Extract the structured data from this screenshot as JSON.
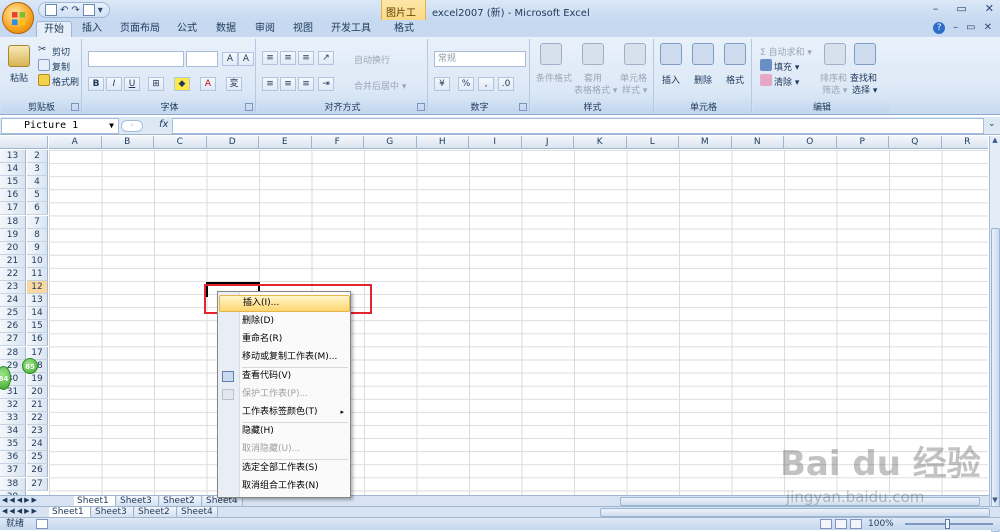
{
  "window": {
    "title": "excel2007 (新) - Microsoft Excel",
    "context_tools_label": "图片工具",
    "controls": [
      "–",
      "▭",
      "✕"
    ]
  },
  "qat": {
    "more": "▾"
  },
  "tabs": [
    {
      "label": "开始",
      "active": true
    },
    {
      "label": "插入"
    },
    {
      "label": "页面布局"
    },
    {
      "label": "公式"
    },
    {
      "label": "数据"
    },
    {
      "label": "审阅"
    },
    {
      "label": "视图"
    },
    {
      "label": "开发工具"
    },
    {
      "label": "格式"
    }
  ],
  "ribbon": {
    "clipboard": {
      "label": "剪贴板",
      "paste": "粘贴",
      "cut": "剪切",
      "copy": "复制",
      "painter": "格式刷"
    },
    "font": {
      "label": "字体"
    },
    "align": {
      "label": "对齐方式",
      "wrap": "自动换行",
      "merge": "合并后居中 ▾"
    },
    "number": {
      "label": "数字",
      "format": "常规"
    },
    "styles": {
      "label": "样式",
      "cond": "条件格式",
      "table": "套用",
      "table2": "表格格式 ▾",
      "cell": "单元格",
      "cell2": "样式 ▾"
    },
    "cells": {
      "label": "单元格",
      "insert": "插入",
      "delete": "删除",
      "format": "格式"
    },
    "editing": {
      "label": "编辑",
      "autosum": "Σ 自动求和 ▾",
      "fill": "填充 ▾",
      "clear": "清除 ▾",
      "sort": "排序和",
      "sort2": "筛选 ▾",
      "find": "查找和",
      "find2": "选择 ▾"
    }
  },
  "formula_bar": {
    "name_box": "Picture 1",
    "fx": "fx",
    "value": ""
  },
  "columns": [
    "A",
    "B",
    "C",
    "D",
    "E",
    "F",
    "G",
    "H",
    "I",
    "J",
    "K",
    "L",
    "M",
    "N",
    "O",
    "P",
    "Q",
    "R"
  ],
  "rows_outer": [
    "13",
    "14",
    "15",
    "16",
    "17",
    "18",
    "19",
    "20",
    "21",
    "22",
    "23",
    "24",
    "25",
    "26",
    "27",
    "28",
    "29",
    "30",
    "31",
    "32",
    "33",
    "34",
    "35",
    "36",
    "37",
    "38",
    "39"
  ],
  "rows_inner": [
    "2",
    "3",
    "4",
    "5",
    "6",
    "7",
    "8",
    "9",
    "10",
    "11",
    "12",
    "13",
    "14",
    "15",
    "16",
    "17",
    "18",
    "19",
    "20",
    "21",
    "22",
    "23",
    "24",
    "25",
    "26",
    "27"
  ],
  "selected_row_inner": "12",
  "context_menu": {
    "items": [
      {
        "label": "插入(I)...",
        "highlight": true
      },
      {
        "label": "删除(D)"
      },
      {
        "label": "重命名(R)"
      },
      {
        "label": "移动或复制工作表(M)..."
      },
      {
        "label": "查看代码(V)"
      },
      {
        "label": "保护工作表(P)...",
        "disabled": true
      },
      {
        "label": "工作表标签颜色(T)",
        "submenu": "▸"
      },
      {
        "label": "隐藏(H)"
      },
      {
        "label": "取消隐藏(U)...",
        "disabled": true
      },
      {
        "label": "选定全部工作表(S)"
      },
      {
        "label": "取消组合工作表(N)"
      }
    ]
  },
  "sheets_back": [
    "Sheet1",
    "Sheet3",
    "Sheet2",
    "Sheet4"
  ],
  "sheets_front": [
    "Sheet1",
    "Sheet3",
    "Sheet2",
    "Sheet4"
  ],
  "bubbles": {
    "b1": "64",
    "b2": "65"
  },
  "status": {
    "ready": "就绪",
    "zoom": "100%"
  },
  "watermark": {
    "text": "Bai du 经验",
    "url": "jingyan.baidu.com"
  },
  "colors": {
    "accent": "#c6d9f1",
    "highlight_red": "#e2262f",
    "menu_hover": "#ffd670"
  }
}
